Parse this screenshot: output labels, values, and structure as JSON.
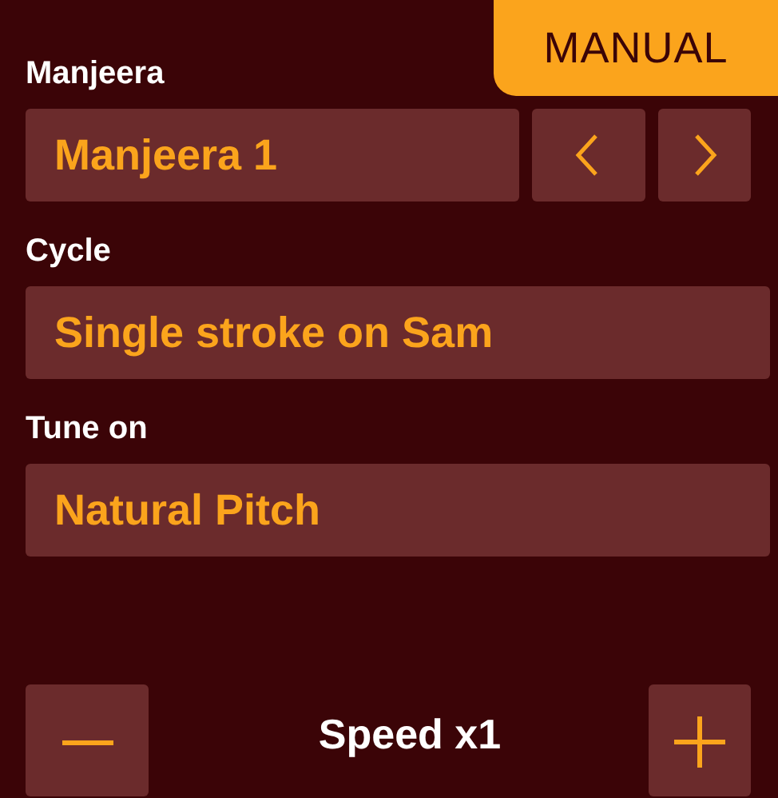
{
  "mode_badge": "MANUAL",
  "fields": [
    {
      "kind": "stepper",
      "label": "Manjeera",
      "value": "Manjeera 1"
    },
    {
      "kind": "select",
      "label": "Cycle",
      "value": "Single stroke on Sam"
    },
    {
      "kind": "select",
      "label": "Tune on",
      "value": "Natural Pitch"
    }
  ],
  "speed": {
    "label": "Speed x1"
  }
}
